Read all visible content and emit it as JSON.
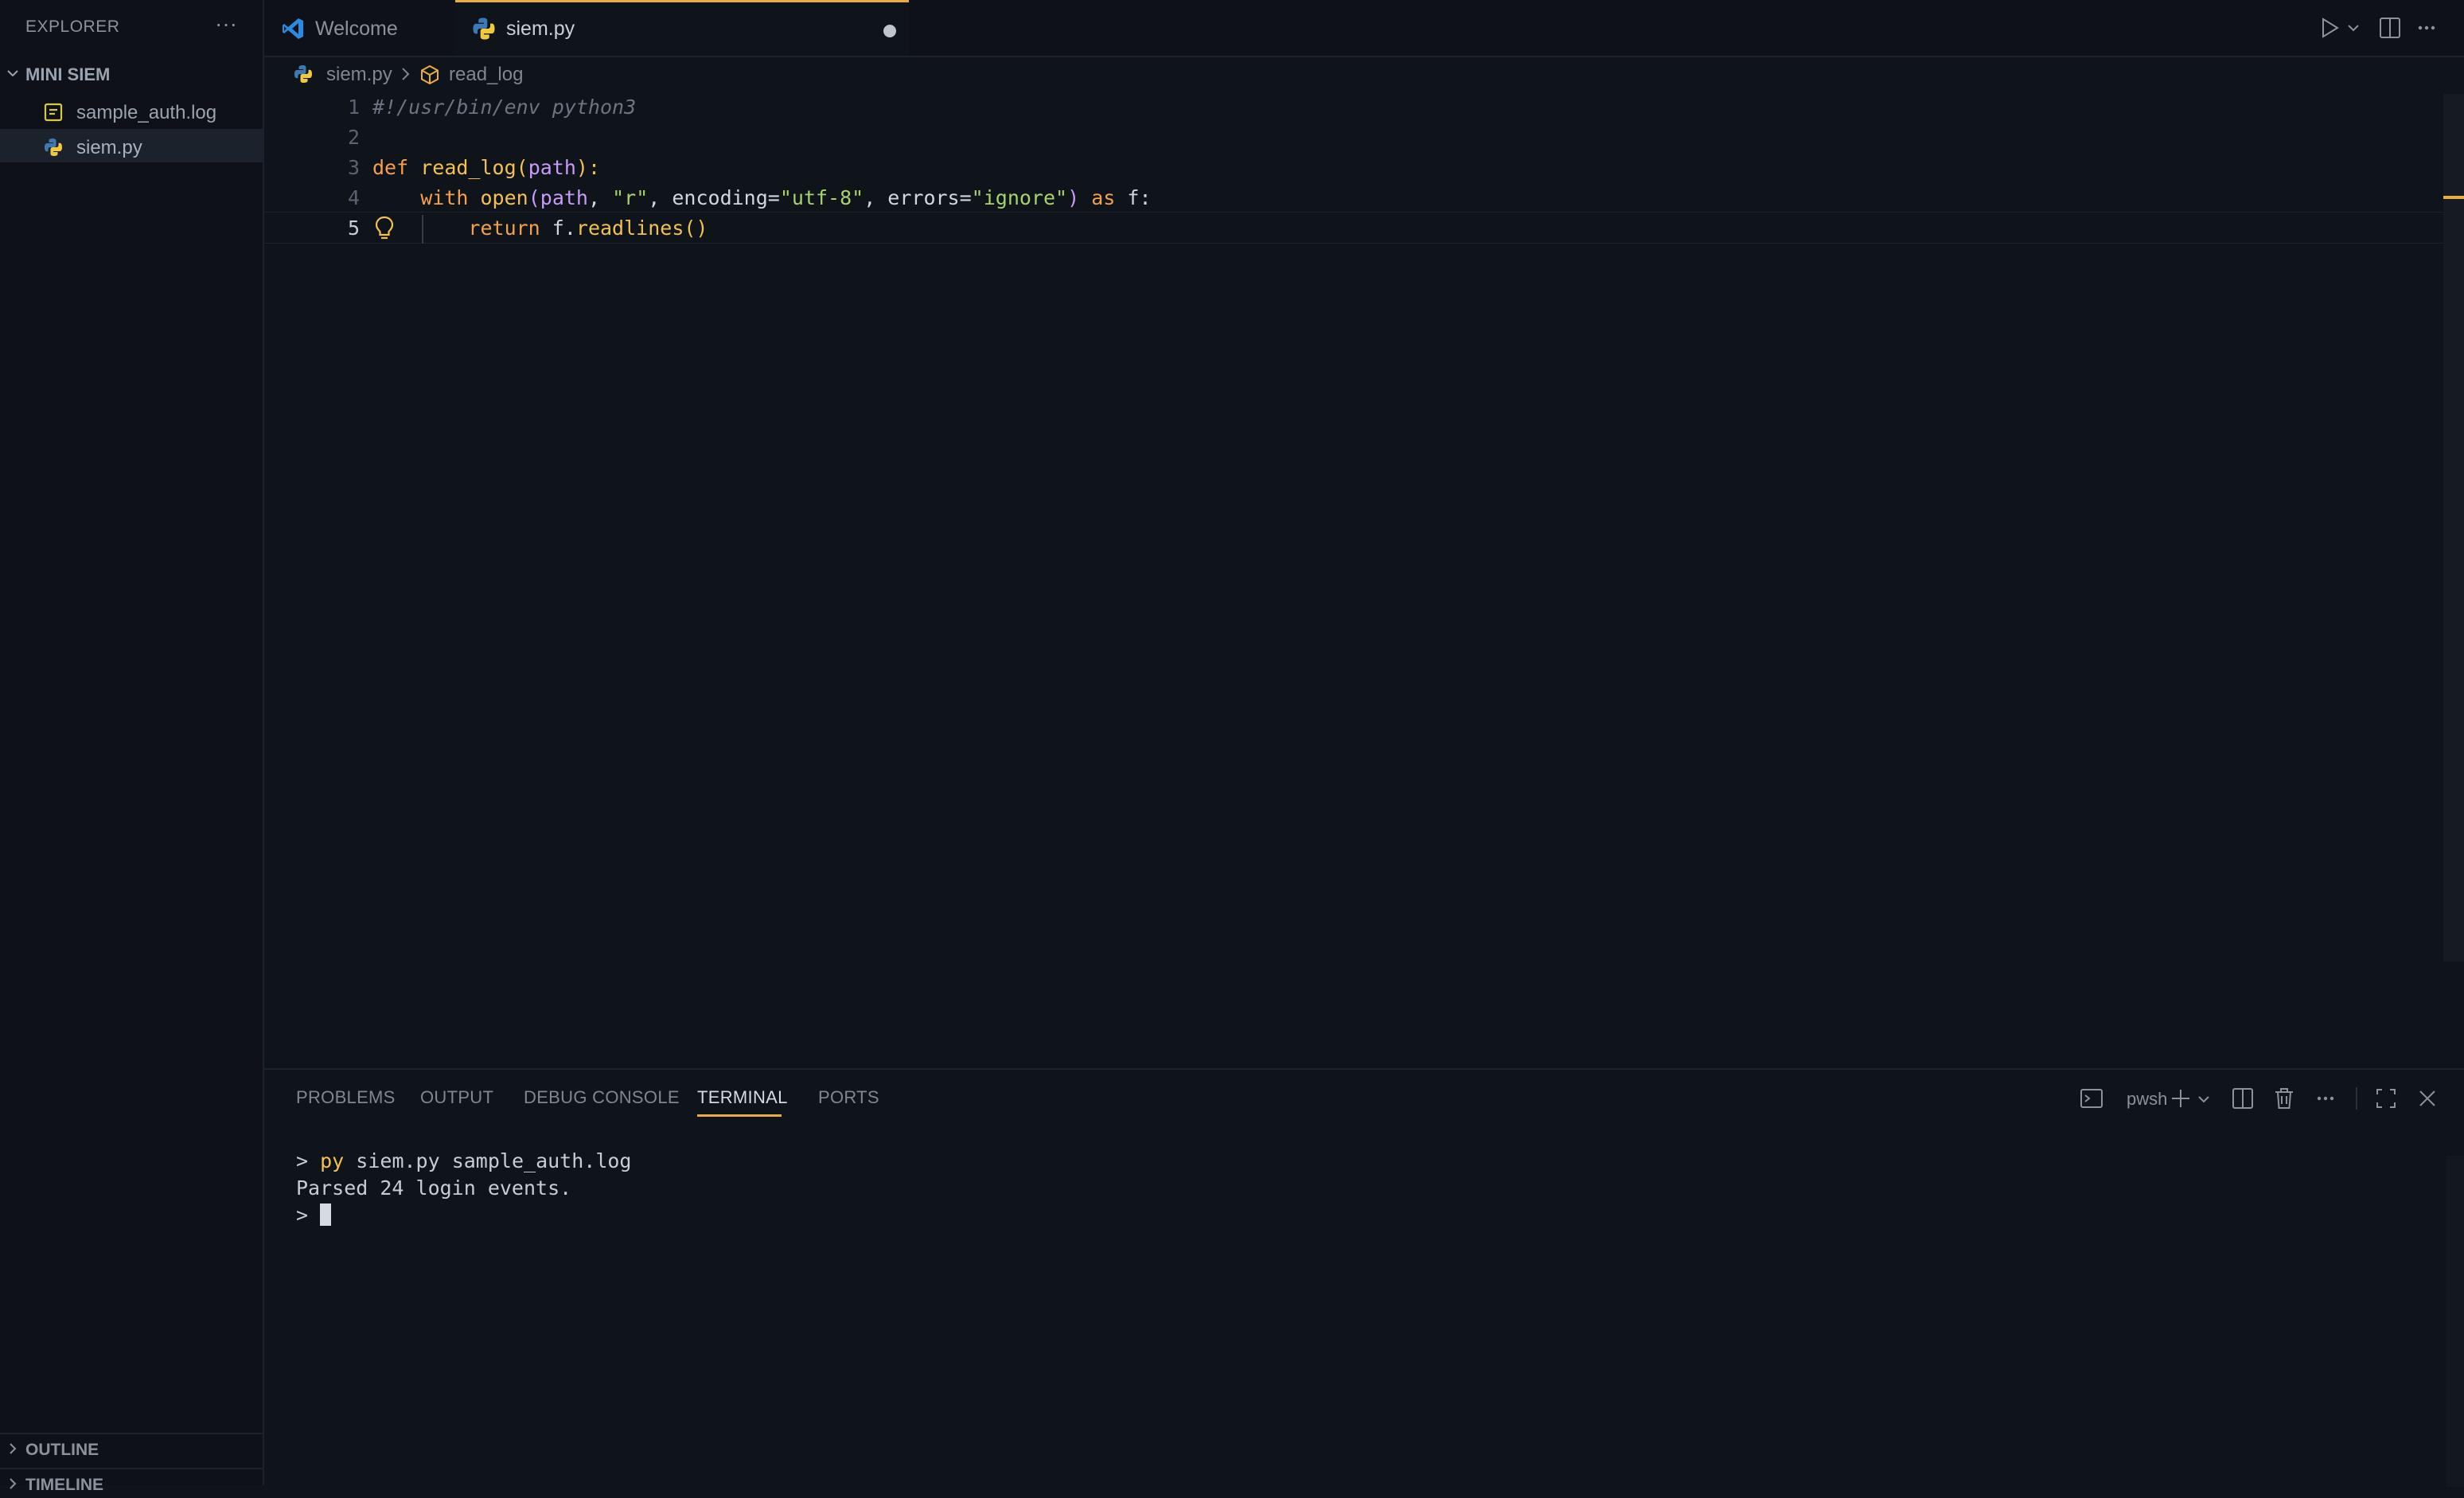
{
  "sidebar": {
    "header": "EXPLORER",
    "folder": "MINI SIEM",
    "files": [
      {
        "name": "sample_auth.log",
        "icon": "log-file-icon"
      },
      {
        "name": "siem.py",
        "icon": "python-icon"
      }
    ],
    "sections": [
      "OUTLINE",
      "TIMELINE"
    ]
  },
  "tabs": [
    {
      "label": "Welcome",
      "icon": "vscode-logo-icon"
    },
    {
      "label": "siem.py",
      "icon": "python-icon",
      "modified": true
    }
  ],
  "breadcrumb": {
    "file": "siem.py",
    "symbol": "read_log"
  },
  "editor": {
    "line_numbers": [
      "1",
      "2",
      "3",
      "4",
      "5"
    ],
    "line1": "#!/usr/bin/env python3",
    "line3": {
      "kw": "def",
      "fn": "read_log",
      "p1": "(",
      "param": "path",
      "p2": "):"
    },
    "line4": {
      "kw": "with",
      "fn": "open",
      "p1": "(",
      "param": "path",
      "c1": ", ",
      "s1": "\"r\"",
      "c2": ", encoding=",
      "s2": "\"utf-8\"",
      "c3": ", errors=",
      "s3": "\"ignore\"",
      "p2": ")",
      "kw2": "as",
      "tail": "f:"
    },
    "line5": {
      "kw": "return",
      "obj": "f.",
      "fn": "readlines",
      "paren": "()"
    }
  },
  "panel": {
    "tabs": [
      "PROBLEMS",
      "OUTPUT",
      "DEBUG CONSOLE",
      "TERMINAL",
      "PORTS"
    ],
    "active_tab": "TERMINAL",
    "shell": "pwsh",
    "terminal": {
      "prompt": ">",
      "cmd": "py",
      "args": "siem.py sample_auth.log",
      "output": "Parsed 24 login events."
    }
  },
  "colors": {
    "accent": "#e8ad3d",
    "background": "#0f131a",
    "keyword": "#f5a04a",
    "function": "#f2c14f",
    "string": "#a6d36b",
    "parameter": "#c79bf7"
  }
}
